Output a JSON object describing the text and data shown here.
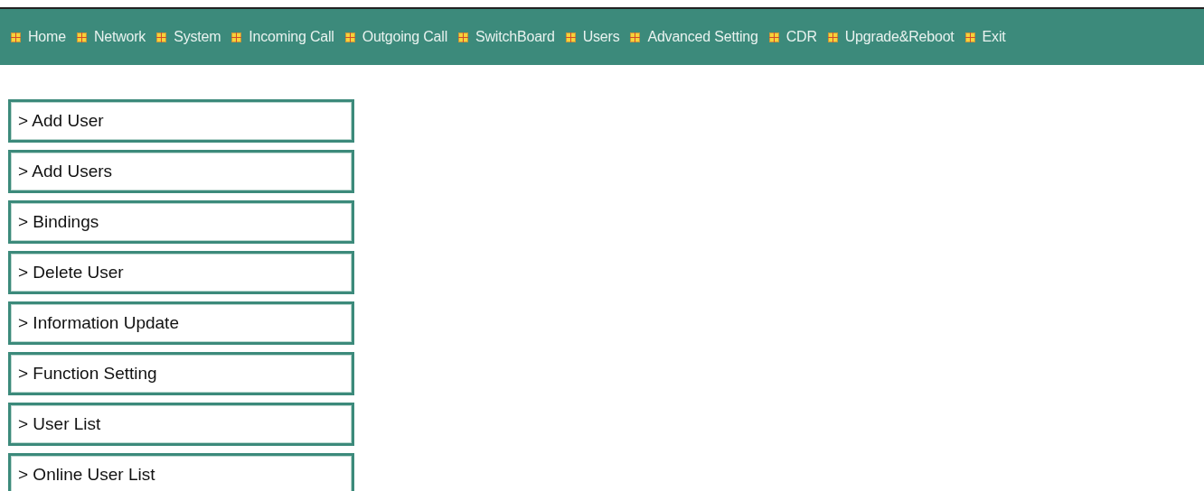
{
  "menu_bar": [
    {
      "label": "Home"
    },
    {
      "label": "Network"
    },
    {
      "label": "System"
    },
    {
      "label": "Incoming Call"
    },
    {
      "label": "Outgoing Call"
    },
    {
      "label": "SwitchBoard"
    },
    {
      "label": "Users"
    },
    {
      "label": "Advanced Setting"
    },
    {
      "label": "CDR"
    },
    {
      "label": "Upgrade&Reboot"
    },
    {
      "label": "Exit"
    }
  ],
  "sidebar": {
    "items": [
      {
        "label": "> Add User"
      },
      {
        "label": "> Add Users"
      },
      {
        "label": "> Bindings"
      },
      {
        "label": "> Delete User"
      },
      {
        "label": "> Information Update"
      },
      {
        "label": "> Function Setting"
      },
      {
        "label": "> User List"
      },
      {
        "label": "> Online User List"
      }
    ]
  }
}
